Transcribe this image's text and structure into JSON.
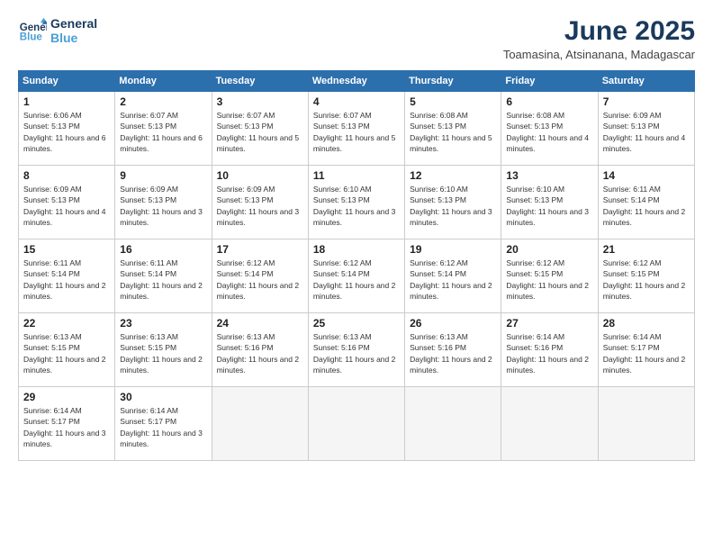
{
  "header": {
    "logo_line1": "General",
    "logo_line2": "Blue",
    "month": "June 2025",
    "location": "Toamasina, Atsinanana, Madagascar"
  },
  "weekdays": [
    "Sunday",
    "Monday",
    "Tuesday",
    "Wednesday",
    "Thursday",
    "Friday",
    "Saturday"
  ],
  "weeks": [
    [
      {
        "day": "1",
        "rise": "6:06 AM",
        "set": "5:13 PM",
        "daylight": "11 hours and 6 minutes"
      },
      {
        "day": "2",
        "rise": "6:07 AM",
        "set": "5:13 PM",
        "daylight": "11 hours and 6 minutes"
      },
      {
        "day": "3",
        "rise": "6:07 AM",
        "set": "5:13 PM",
        "daylight": "11 hours and 5 minutes"
      },
      {
        "day": "4",
        "rise": "6:07 AM",
        "set": "5:13 PM",
        "daylight": "11 hours and 5 minutes"
      },
      {
        "day": "5",
        "rise": "6:08 AM",
        "set": "5:13 PM",
        "daylight": "11 hours and 5 minutes"
      },
      {
        "day": "6",
        "rise": "6:08 AM",
        "set": "5:13 PM",
        "daylight": "11 hours and 4 minutes"
      },
      {
        "day": "7",
        "rise": "6:09 AM",
        "set": "5:13 PM",
        "daylight": "11 hours and 4 minutes"
      }
    ],
    [
      {
        "day": "8",
        "rise": "6:09 AM",
        "set": "5:13 PM",
        "daylight": "11 hours and 4 minutes"
      },
      {
        "day": "9",
        "rise": "6:09 AM",
        "set": "5:13 PM",
        "daylight": "11 hours and 3 minutes"
      },
      {
        "day": "10",
        "rise": "6:09 AM",
        "set": "5:13 PM",
        "daylight": "11 hours and 3 minutes"
      },
      {
        "day": "11",
        "rise": "6:10 AM",
        "set": "5:13 PM",
        "daylight": "11 hours and 3 minutes"
      },
      {
        "day": "12",
        "rise": "6:10 AM",
        "set": "5:13 PM",
        "daylight": "11 hours and 3 minutes"
      },
      {
        "day": "13",
        "rise": "6:10 AM",
        "set": "5:13 PM",
        "daylight": "11 hours and 3 minutes"
      },
      {
        "day": "14",
        "rise": "6:11 AM",
        "set": "5:14 PM",
        "daylight": "11 hours and 2 minutes"
      }
    ],
    [
      {
        "day": "15",
        "rise": "6:11 AM",
        "set": "5:14 PM",
        "daylight": "11 hours and 2 minutes"
      },
      {
        "day": "16",
        "rise": "6:11 AM",
        "set": "5:14 PM",
        "daylight": "11 hours and 2 minutes"
      },
      {
        "day": "17",
        "rise": "6:12 AM",
        "set": "5:14 PM",
        "daylight": "11 hours and 2 minutes"
      },
      {
        "day": "18",
        "rise": "6:12 AM",
        "set": "5:14 PM",
        "daylight": "11 hours and 2 minutes"
      },
      {
        "day": "19",
        "rise": "6:12 AM",
        "set": "5:14 PM",
        "daylight": "11 hours and 2 minutes"
      },
      {
        "day": "20",
        "rise": "6:12 AM",
        "set": "5:15 PM",
        "daylight": "11 hours and 2 minutes"
      },
      {
        "day": "21",
        "rise": "6:12 AM",
        "set": "5:15 PM",
        "daylight": "11 hours and 2 minutes"
      }
    ],
    [
      {
        "day": "22",
        "rise": "6:13 AM",
        "set": "5:15 PM",
        "daylight": "11 hours and 2 minutes"
      },
      {
        "day": "23",
        "rise": "6:13 AM",
        "set": "5:15 PM",
        "daylight": "11 hours and 2 minutes"
      },
      {
        "day": "24",
        "rise": "6:13 AM",
        "set": "5:16 PM",
        "daylight": "11 hours and 2 minutes"
      },
      {
        "day": "25",
        "rise": "6:13 AM",
        "set": "5:16 PM",
        "daylight": "11 hours and 2 minutes"
      },
      {
        "day": "26",
        "rise": "6:13 AM",
        "set": "5:16 PM",
        "daylight": "11 hours and 2 minutes"
      },
      {
        "day": "27",
        "rise": "6:14 AM",
        "set": "5:16 PM",
        "daylight": "11 hours and 2 minutes"
      },
      {
        "day": "28",
        "rise": "6:14 AM",
        "set": "5:17 PM",
        "daylight": "11 hours and 2 minutes"
      }
    ],
    [
      {
        "day": "29",
        "rise": "6:14 AM",
        "set": "5:17 PM",
        "daylight": "11 hours and 3 minutes"
      },
      {
        "day": "30",
        "rise": "6:14 AM",
        "set": "5:17 PM",
        "daylight": "11 hours and 3 minutes"
      },
      null,
      null,
      null,
      null,
      null
    ]
  ],
  "labels": {
    "sunrise": "Sunrise:",
    "sunset": "Sunset:",
    "daylight": "Daylight:"
  }
}
